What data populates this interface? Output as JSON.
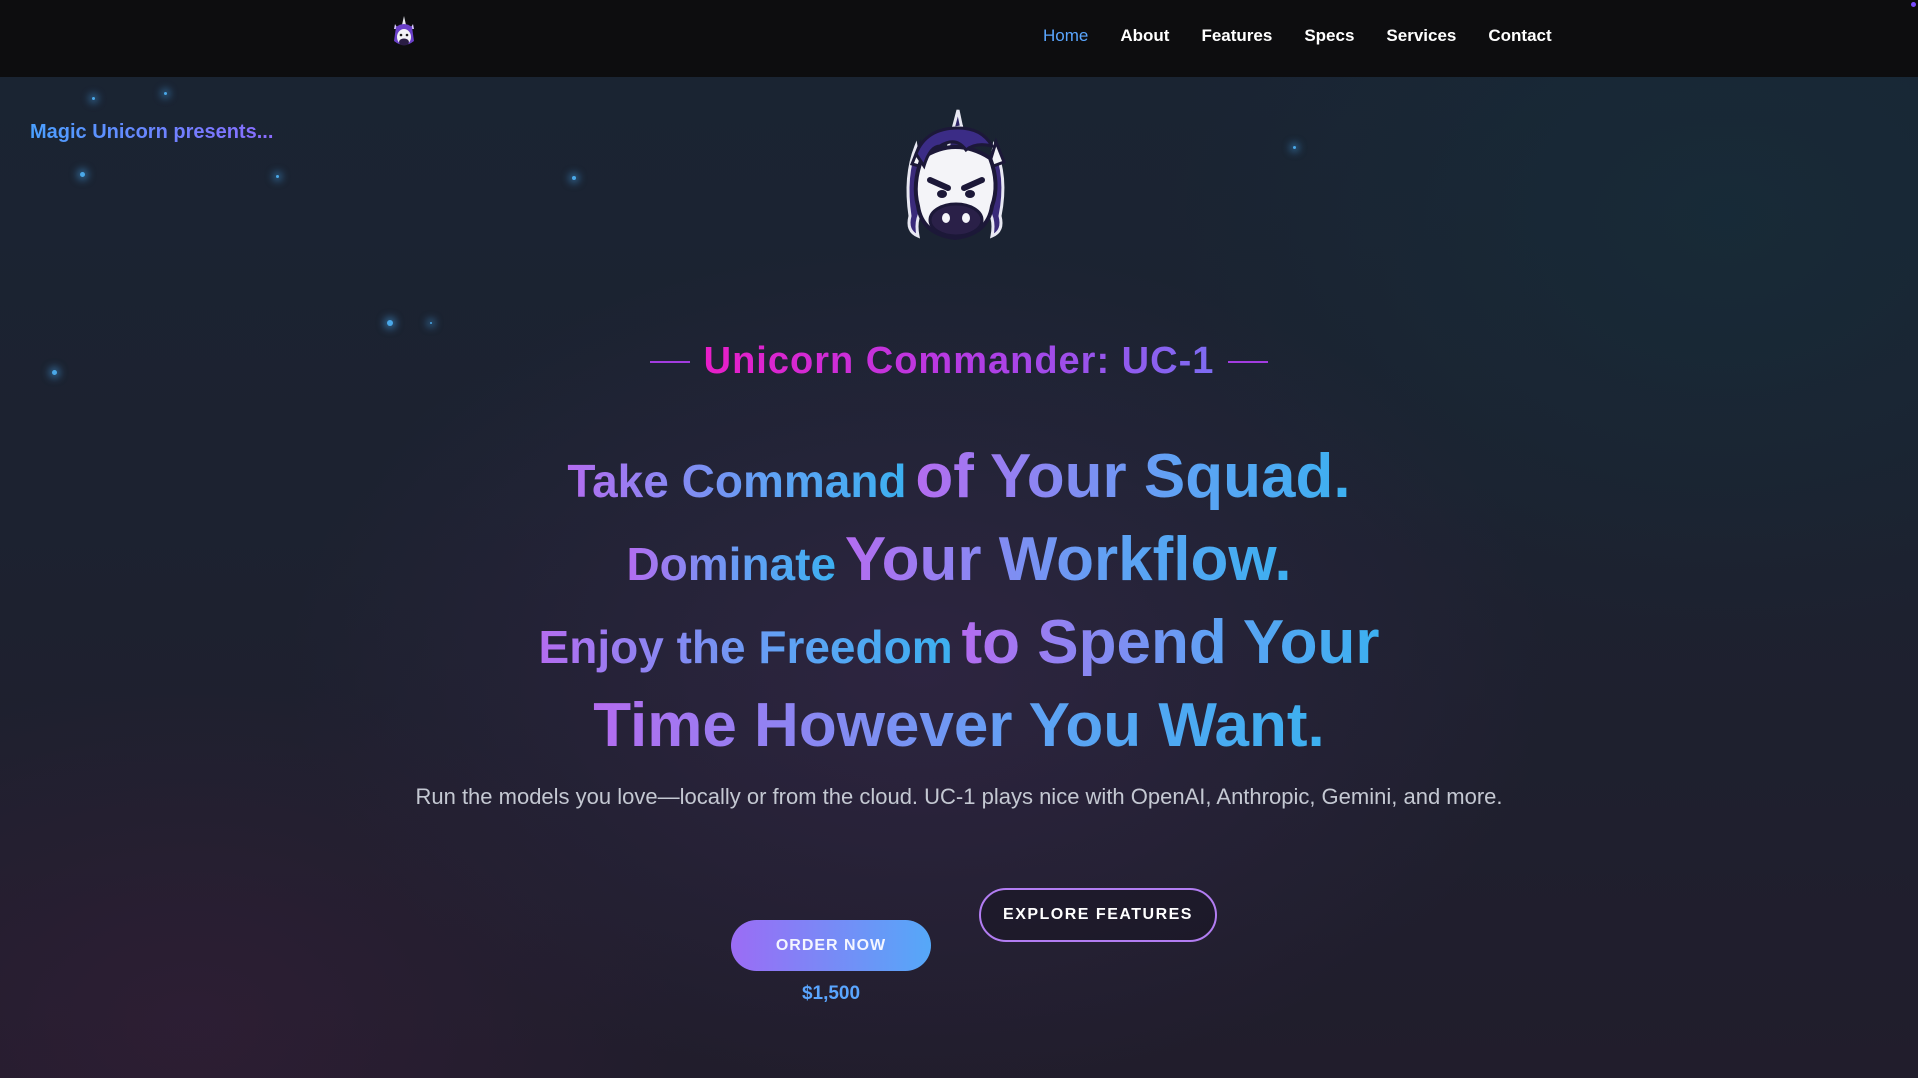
{
  "nav": {
    "logo_icon": "unicorn-logo-icon",
    "links": [
      "Home",
      "About",
      "Features",
      "Specs",
      "Services",
      "Contact"
    ],
    "active": "Home"
  },
  "presents": "Magic Unicorn presents...",
  "hero": {
    "mascot_icon": "unicorn-mascot-icon",
    "subtitle": "Unicorn Commander: UC-1",
    "headline": {
      "l1_a": "Take Command",
      "l1_b": "of Your Squad.",
      "l2_a": "Dominate",
      "l2_b": "Your Workflow.",
      "l3_a": "Enjoy the Freedom",
      "l3_b": "to Spend Your",
      "l4": "Time However You Want."
    },
    "tagline": "Run the models you love—locally or from the cloud. UC-1 plays nice with OpenAI, Anthropic, Gemini, and more.",
    "order_label": "ORDER NOW",
    "price": "$1,500",
    "explore_label": "EXPLORE FEATURES"
  },
  "colors": {
    "accent_blue": "#5aa6ff",
    "accent_purple": "#9b6cf5",
    "accent_magenta": "#e81ec8",
    "nav_bg": "#0d0d0f"
  }
}
